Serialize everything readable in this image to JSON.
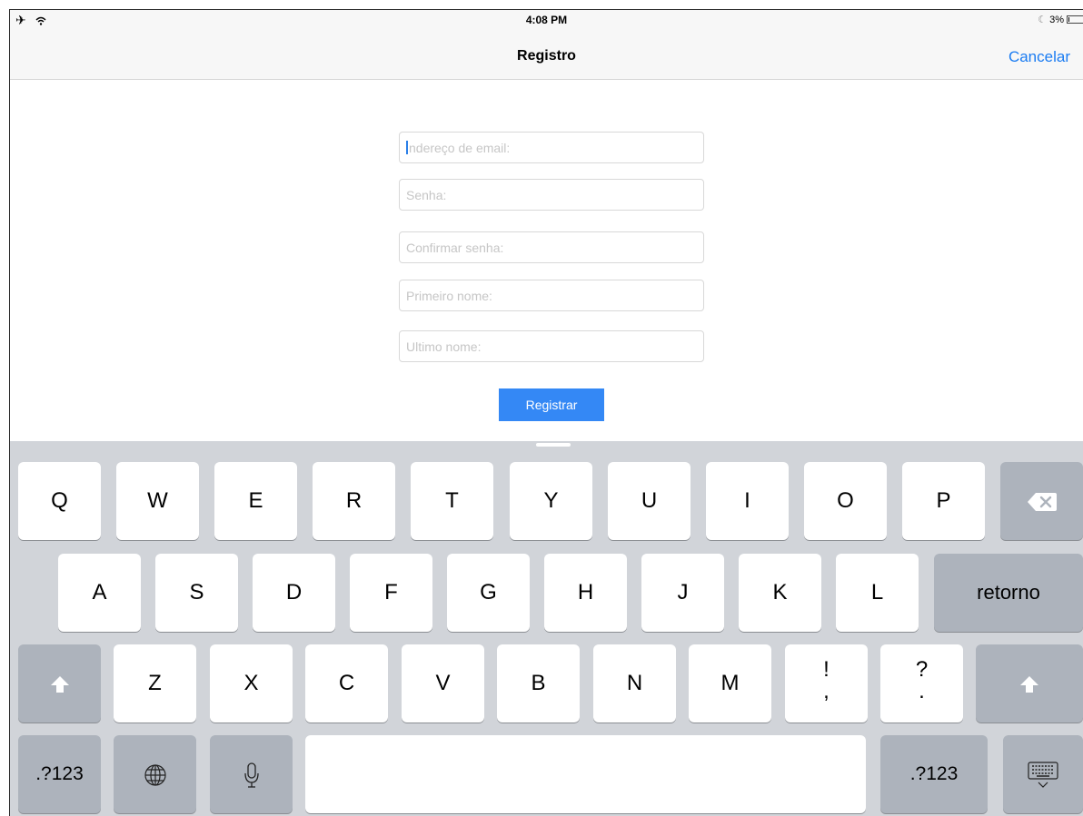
{
  "status_bar": {
    "time": "4:08 PM",
    "battery": "3%",
    "left_icons": [
      "airplane-icon",
      "wifi-icon"
    ]
  },
  "nav": {
    "title": "Registro",
    "cancel_label": "Cancelar"
  },
  "form": {
    "email_placeholder": "Endereço de email:",
    "email_placeholder_rest": "ndereço de email:",
    "password_placeholder": "Senha:",
    "confirm_password_placeholder": "Confirmar senha:",
    "first_name_placeholder": "Primeiro nome:",
    "last_name_placeholder": "Ultimo nome:",
    "submit_label": "Registrar"
  },
  "keyboard": {
    "row1": [
      "Q",
      "W",
      "E",
      "R",
      "T",
      "Y",
      "U",
      "I",
      "O",
      "P"
    ],
    "row2": [
      "A",
      "S",
      "D",
      "F",
      "G",
      "H",
      "J",
      "K",
      "L"
    ],
    "row3": [
      "Z",
      "X",
      "C",
      "V",
      "B",
      "N",
      "M"
    ],
    "return_label": "retorno",
    "numbers_label": ".?123",
    "punct_excl_top": "!",
    "punct_excl_bottom": ",",
    "punct_q_top": "?",
    "punct_q_bottom": ".",
    "colors": {
      "keyboard_bg": "#d1d4d9",
      "func_key": "#adb3bc",
      "accent": "#1b7cf2",
      "button": "#3488f5"
    }
  }
}
